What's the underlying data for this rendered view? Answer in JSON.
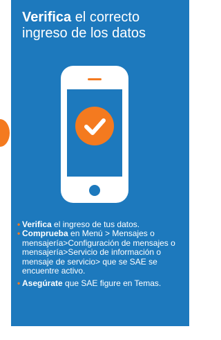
{
  "title": {
    "bold": "Verifica",
    "rest_line1": " el correcto",
    "line2": "ingreso de los datos"
  },
  "bullets": [
    {
      "bold": "Verifica",
      "text": " el ingreso de tus datos."
    },
    {
      "bold": "Comprueba",
      "text": "  en Menú > Mensajes o mensajería>Configuración de mensajes o mensajería>Servicio de información o mensaje de servicio> que se SAE se encuentre activo."
    },
    {
      "bold": "Asegúrate",
      "text": " que SAE figure en Temas."
    }
  ],
  "colors": {
    "panel": "#1d79bd",
    "accent": "#f47a1f",
    "text": "#ffffff"
  },
  "icons": {
    "phone": "smartphone-icon",
    "check": "checkmark-icon"
  }
}
